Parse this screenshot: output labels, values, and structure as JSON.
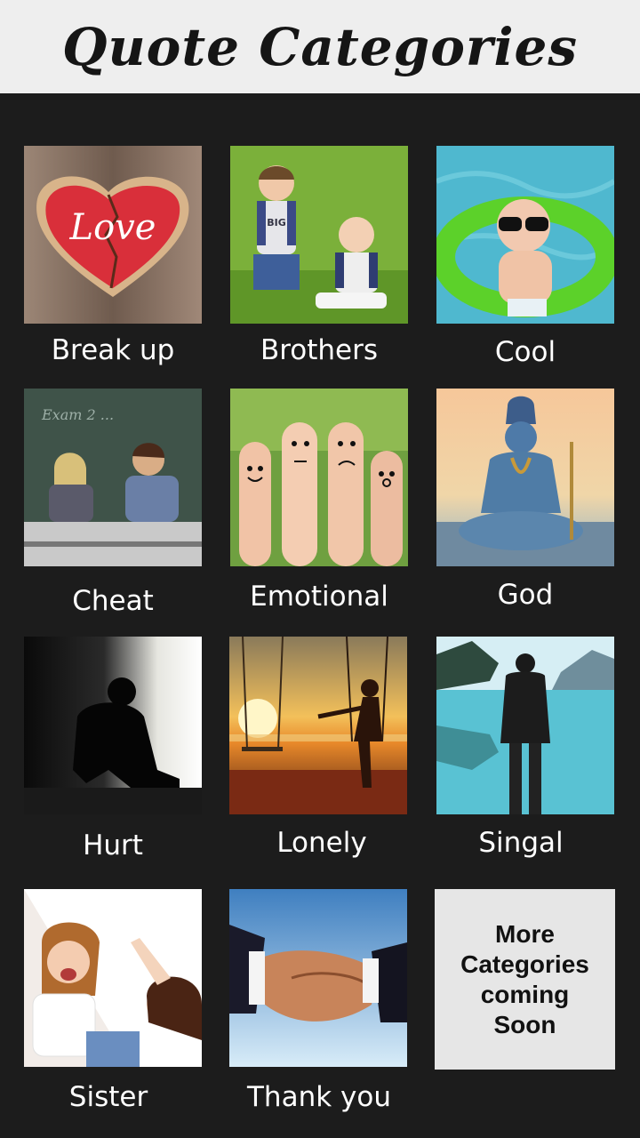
{
  "header": {
    "title": "Quote Categories"
  },
  "categories": [
    {
      "label": "Break up",
      "image": "broken-heart-cookie-photo"
    },
    {
      "label": "Brothers",
      "image": "two-brothers-photo"
    },
    {
      "label": "Cool",
      "image": "baby-sunglasses-photo"
    },
    {
      "label": "Cheat",
      "image": "students-exam-photo"
    },
    {
      "label": "Emotional",
      "image": "finger-faces-photo"
    },
    {
      "label": "God",
      "image": "shiva-statue-photo"
    },
    {
      "label": "Hurt",
      "image": "sad-silhouette-photo"
    },
    {
      "label": "Lonely",
      "image": "swing-sunset-photo"
    },
    {
      "label": "Singal",
      "image": "man-lake-photo"
    },
    {
      "label": "Sister",
      "image": "sisters-laughing-photo"
    },
    {
      "label": "Thank you",
      "image": "handshake-photo"
    }
  ],
  "more": {
    "lines": [
      "More",
      "Categories",
      "coming",
      "Soon"
    ]
  }
}
